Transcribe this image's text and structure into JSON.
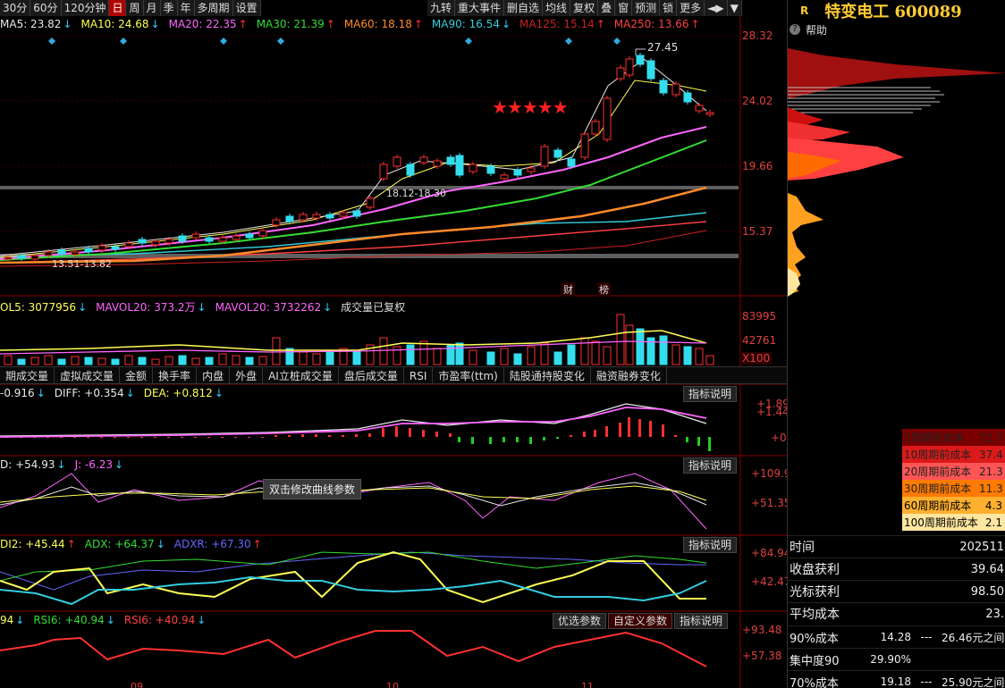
{
  "toolbar": {
    "periods": [
      "30分",
      "60分",
      "120分钟",
      "日",
      "周",
      "月",
      "季",
      "年",
      "多周期",
      "设置"
    ],
    "active_period": "日",
    "right_buttons": [
      "九转",
      "重大事件",
      "删自选",
      "均线",
      "复权",
      "叠",
      "窗",
      "预测",
      "锁",
      "更多"
    ],
    "arrow_glyph": "◄▶",
    "dropdown_glyph": "▼"
  },
  "ma_legend": [
    {
      "text": "MA5: 23.82",
      "arrow": "↓",
      "color": "#e8e8e8"
    },
    {
      "text": "MA10: 24.68",
      "arrow": "↓",
      "color": "#ffff55"
    },
    {
      "text": "MA20: 22.35",
      "arrow": "↑",
      "color": "#ff66ff"
    },
    {
      "text": "MA30: 21.39",
      "arrow": "↑",
      "color": "#33dd33"
    },
    {
      "text": "MA60: 18.18",
      "arrow": "↑",
      "color": "#ff8a2a"
    },
    {
      "text": "MA90: 16.54",
      "arrow": "↓",
      "color": "#33ccdd"
    },
    {
      "text": "MA125: 15.14",
      "arrow": "↑",
      "color": "#cc2020"
    },
    {
      "text": "MA250: 13.66",
      "arrow": "↑",
      "color": "#ff4040"
    }
  ],
  "price_axis": [
    "28.32",
    "24.02",
    "19.66",
    "15.37"
  ],
  "annotations": {
    "high": "27.45",
    "band_upper": "18.12-18.30",
    "band_lower": "13.51-13.82",
    "badge1": "财",
    "badge2": "榜",
    "stars": "★★★★★"
  },
  "vol_legend": [
    {
      "text": "OL5: 3077956",
      "arrow": "↓",
      "color": "#ffff55"
    },
    {
      "text": "MAVOL20: 373.2万",
      "arrow": "↓",
      "color": "#ff66ff"
    },
    {
      "text": "MAVOL20: 3732262",
      "arrow": "↓",
      "color": "#ff66ff"
    },
    {
      "text": "成交量已复权",
      "arrow": "",
      "color": "#dddddd"
    }
  ],
  "vol_axis": [
    "83995",
    "42761",
    "X100"
  ],
  "indicator_tabs": [
    "期成交量",
    "虚拟成交量",
    "金额",
    "换手率",
    "内盘",
    "外盘",
    "AI立桩成交量",
    "盘后成交量",
    "RSI",
    "市盈率(ttm)",
    "陆股通持股变化",
    "融资融券变化"
  ],
  "macd": {
    "legend": [
      {
        "text": "-0.916",
        "arrow": "↓",
        "color": "#e8e8e8"
      },
      {
        "text": "DIFF: +0.354",
        "arrow": "↓",
        "color": "#e8e8e8"
      },
      {
        "text": "DEA: +0.812",
        "arrow": "↓",
        "color": "#ffff55"
      }
    ],
    "axis": [
      "+1.89",
      "+1.44",
      "+0"
    ],
    "help": "指标说明"
  },
  "kdj": {
    "legend": [
      {
        "text": "D: +54.93",
        "arrow": "↓",
        "color": "#e8e8e8"
      },
      {
        "text": "J: -6.23",
        "arrow": "↓",
        "color": "#ff66ff"
      }
    ],
    "axis": [
      "+109.9",
      "+51.35"
    ],
    "help": "指标说明",
    "tooltip": "双击修改曲线参数"
  },
  "dmi": {
    "legend": [
      {
        "text": "DI2: +45.44",
        "arrow": "↑",
        "color": "#ffff55"
      },
      {
        "text": "ADX: +64.37",
        "arrow": "↓",
        "color": "#33dd33"
      },
      {
        "text": "ADXR: +67.30",
        "arrow": "↑",
        "color": "#6666ff"
      }
    ],
    "axis": [
      "+84.94",
      "+42.47"
    ],
    "help": "指标说明"
  },
  "rsi": {
    "legend": [
      {
        "text": "94",
        "arrow": "↓",
        "color": "#ffff55"
      },
      {
        "text": "RSI6: +40.94",
        "arrow": "↓",
        "color": "#33dd33"
      },
      {
        "text": "RSI6: +40.94",
        "arrow": "↓",
        "color": "#ff4040"
      }
    ],
    "axis": [
      "+93.48",
      "+57.38"
    ],
    "buttons": [
      "优选参数",
      "自定义参数",
      "指标说明"
    ]
  },
  "date_axis": [
    "09",
    "10",
    "11"
  ],
  "right_panel": {
    "logo": "R",
    "title": "特变电工 600089",
    "help": "帮助",
    "cost_rows": [
      {
        "label": "5周期前成本",
        "value": "72.7",
        "bg": "#7a0000"
      },
      {
        "label": "10周期前成本",
        "value": "37.4",
        "bg": "#dd1a1a"
      },
      {
        "label": "20周期前成本",
        "value": "21.3",
        "bg": "#ff5555"
      },
      {
        "label": "30周期前成本",
        "value": "11.3",
        "bg": "#ff7a00"
      },
      {
        "label": "60周期前成本",
        "value": "4.3",
        "bg": "#ffb030"
      },
      {
        "label": "100周期前成本",
        "value": "2.1",
        "bg": "#ffe6a0"
      }
    ],
    "info_rows": [
      {
        "label": "时间",
        "value": "202511"
      },
      {
        "label": "收盘获利",
        "value": "39.64"
      },
      {
        "label": "光标获利",
        "value": "98.50"
      },
      {
        "label": "平均成本",
        "value": "23."
      }
    ],
    "range_rows": [
      {
        "label": "90%成本",
        "low": "14.28",
        "sep": "---",
        "high": "26.46元之间"
      },
      {
        "label": "集中度90",
        "low": "29.90%",
        "sep": "",
        "high": ""
      },
      {
        "label": "70%成本",
        "low": "19.18",
        "sep": "---",
        "high": "25.90元之间"
      }
    ]
  }
}
